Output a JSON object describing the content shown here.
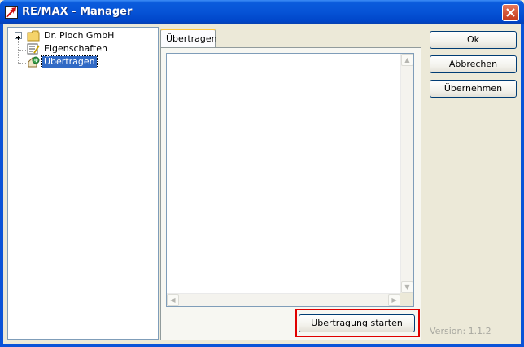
{
  "window": {
    "title": "RE/MAX - Manager"
  },
  "tree": {
    "items": [
      {
        "label": "Dr. Ploch GmbH",
        "icon": "folder-icon",
        "expandable": true
      },
      {
        "label": "Eigenschaften",
        "icon": "properties-icon",
        "expandable": false
      },
      {
        "label": "Übertragen",
        "icon": "transfer-icon",
        "expandable": false,
        "selected": true
      }
    ]
  },
  "tab": {
    "label": "Übertragen"
  },
  "buttons": {
    "ok": "Ok",
    "cancel": "Abbrechen",
    "apply": "Übernehmen",
    "start_transfer": "Übertragung starten"
  },
  "version": "Version: 1.1.2",
  "colors": {
    "titlebar": "#0653d6",
    "selection": "#316ac5",
    "highlight": "#e00000"
  }
}
